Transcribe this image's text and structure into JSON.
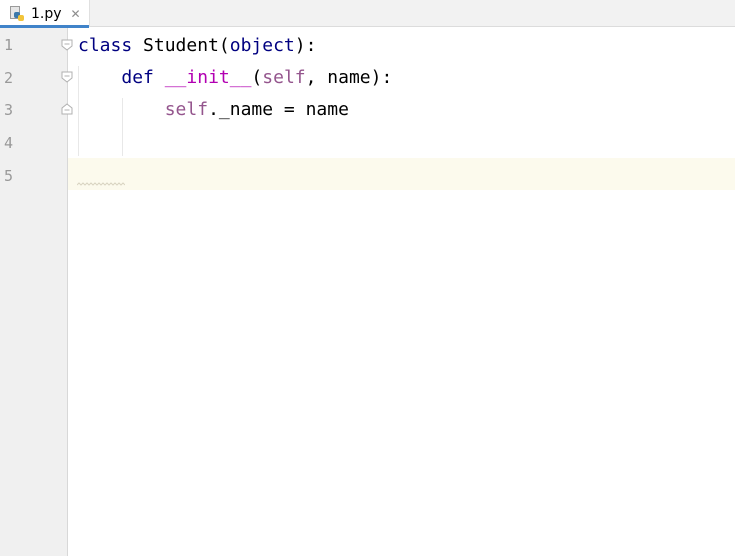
{
  "tab": {
    "label": "1.py",
    "close_glyph": "✕",
    "file_icon": "python-file-icon"
  },
  "editor": {
    "line_numbers": [
      "1",
      "2",
      "3",
      "4",
      "5"
    ],
    "current_line": 5,
    "lines": [
      {
        "tokens": [
          {
            "text": "class",
            "type": "kw"
          },
          {
            "text": " Student(",
            "type": "plain"
          },
          {
            "text": "object",
            "type": "kw"
          },
          {
            "text": "):",
            "type": "plain"
          }
        ]
      },
      {
        "tokens": [
          {
            "text": "    ",
            "type": "plain"
          },
          {
            "text": "def",
            "type": "kw"
          },
          {
            "text": " ",
            "type": "plain"
          },
          {
            "text": "__init__",
            "type": "magic"
          },
          {
            "text": "(",
            "type": "plain"
          },
          {
            "text": "self",
            "type": "selfc"
          },
          {
            "text": ", name):",
            "type": "plain"
          }
        ]
      },
      {
        "tokens": [
          {
            "text": "        ",
            "type": "plain"
          },
          {
            "text": "self",
            "type": "selfc"
          },
          {
            "text": "._name = name",
            "type": "plain"
          }
        ]
      },
      {
        "tokens": []
      },
      {
        "tokens": []
      }
    ]
  },
  "colors": {
    "keyword": "#000080",
    "magic_method": "#b200b2",
    "self": "#94558d",
    "current_line_bg": "#fcfaed",
    "tab_underline": "#4083c9"
  }
}
